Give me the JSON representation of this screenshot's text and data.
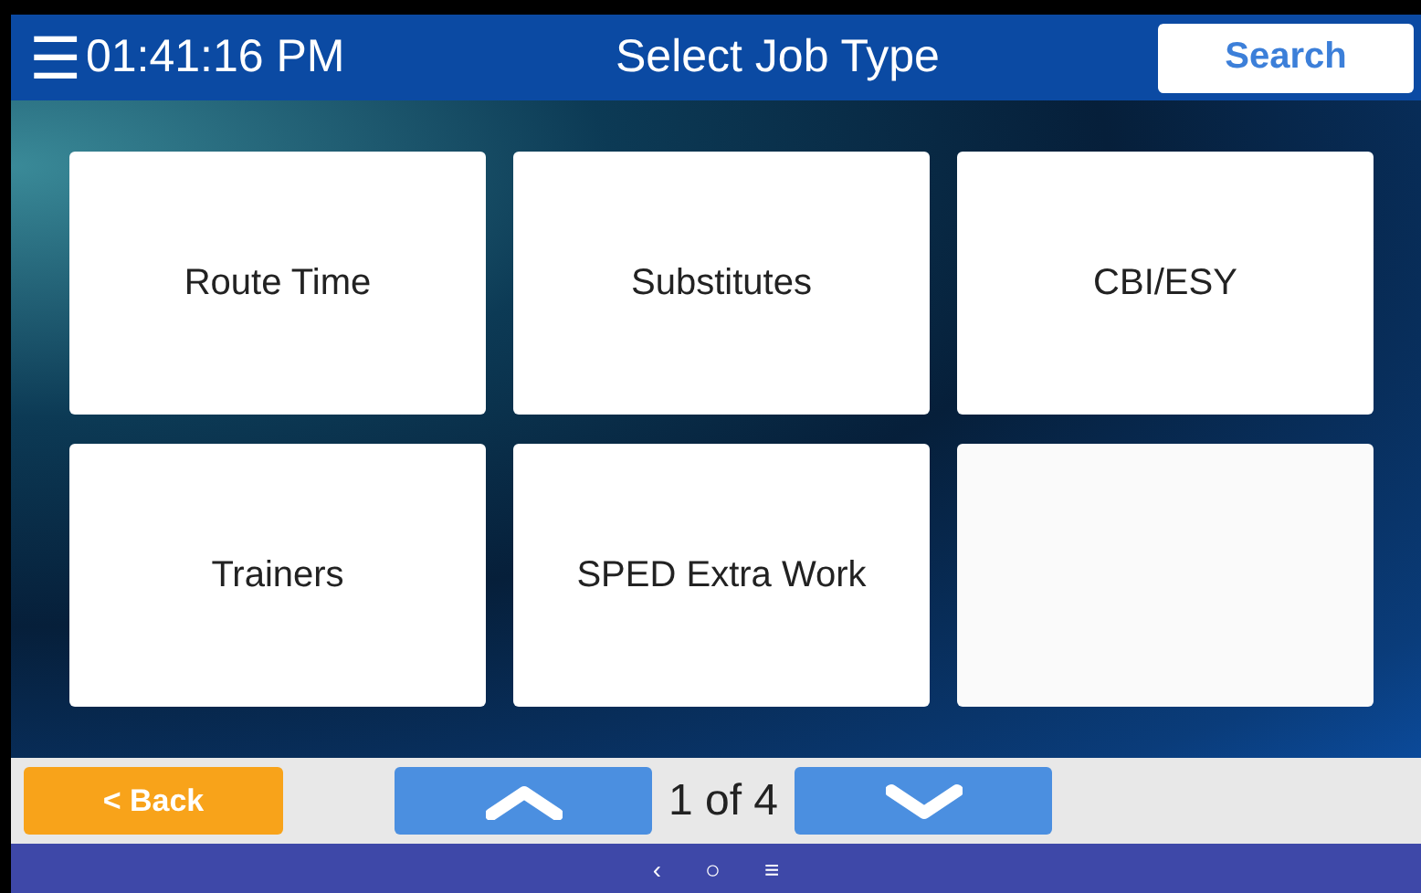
{
  "header": {
    "menu_icon": "☰",
    "clock": "01:41:16 PM",
    "title": "Select Job Type",
    "search_button": "Search"
  },
  "tiles": [
    {
      "kind": "job",
      "label": "Route Time"
    },
    {
      "kind": "job",
      "label": "Substitutes"
    },
    {
      "kind": "job",
      "label": "CBI/ESY"
    },
    {
      "kind": "job",
      "label": "Trainers"
    },
    {
      "kind": "job",
      "label": "SPED Extra Work"
    },
    {
      "kind": "blank"
    }
  ],
  "pager": {
    "back_button": "< Back",
    "page": "1 of 4"
  },
  "system_nav": {
    "back": "‹",
    "home": "○",
    "recents": "≡"
  }
}
